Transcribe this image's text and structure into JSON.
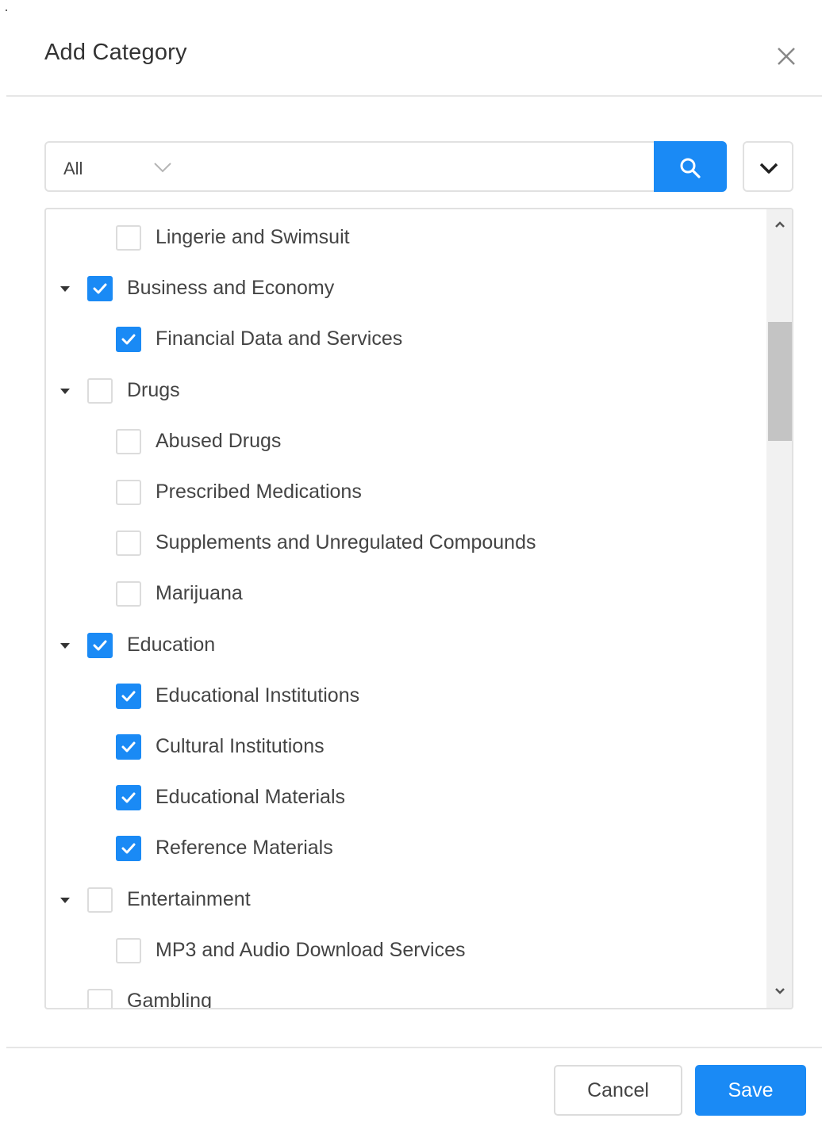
{
  "dialog": {
    "title": "Add Category",
    "close_icon": "close-icon"
  },
  "search": {
    "filter_value": "All",
    "query": "",
    "search_icon": "search-icon",
    "expand_icon": "chevron-down-icon"
  },
  "tree": {
    "items": [
      {
        "label": "Lingerie and Swimsuit",
        "level": 1,
        "checked": false,
        "expandable": false
      },
      {
        "label": "Business and Economy",
        "level": 0,
        "checked": true,
        "expandable": true
      },
      {
        "label": "Financial Data and Services",
        "level": 1,
        "checked": true,
        "expandable": false
      },
      {
        "label": "Drugs",
        "level": 0,
        "checked": false,
        "expandable": true
      },
      {
        "label": "Abused Drugs",
        "level": 1,
        "checked": false,
        "expandable": false
      },
      {
        "label": "Prescribed Medications",
        "level": 1,
        "checked": false,
        "expandable": false
      },
      {
        "label": "Supplements and Unregulated Compounds",
        "level": 1,
        "checked": false,
        "expandable": false
      },
      {
        "label": "Marijuana",
        "level": 1,
        "checked": false,
        "expandable": false
      },
      {
        "label": "Education",
        "level": 0,
        "checked": true,
        "expandable": true
      },
      {
        "label": "Educational Institutions",
        "level": 1,
        "checked": true,
        "expandable": false
      },
      {
        "label": "Cultural Institutions",
        "level": 1,
        "checked": true,
        "expandable": false
      },
      {
        "label": "Educational Materials",
        "level": 1,
        "checked": true,
        "expandable": false
      },
      {
        "label": "Reference Materials",
        "level": 1,
        "checked": true,
        "expandable": false
      },
      {
        "label": "Entertainment",
        "level": 0,
        "checked": false,
        "expandable": true
      },
      {
        "label": "MP3 and Audio Download Services",
        "level": 1,
        "checked": false,
        "expandable": false
      },
      {
        "label": "Gambling",
        "level": 0,
        "checked": false,
        "expandable": false
      }
    ]
  },
  "footer": {
    "cancel_label": "Cancel",
    "save_label": "Save"
  },
  "colors": {
    "accent": "#1a8af5",
    "border": "#e1e1e1"
  }
}
